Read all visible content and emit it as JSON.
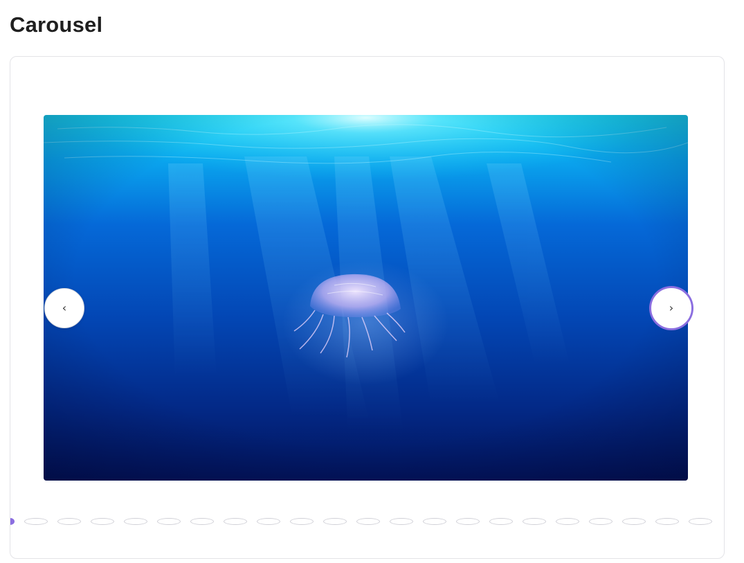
{
  "page": {
    "title": "Carousel"
  },
  "carousel": {
    "prev_label": "‹",
    "next_label": "›",
    "prev_icon": "chevron-left-icon",
    "next_icon": "chevron-right-icon",
    "slide_image": "jellyfish-underwater",
    "dot_count": 22,
    "active_index": 0
  },
  "colors": {
    "accent": "#8b6ee0",
    "title": "#1f1f1f",
    "border": "#e3e3e7"
  }
}
